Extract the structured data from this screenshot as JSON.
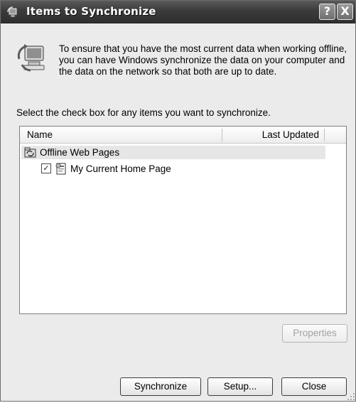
{
  "window": {
    "title": "Items to Synchronize",
    "help_glyph": "?",
    "close_glyph": "X"
  },
  "info": {
    "text": "To ensure that you have the most current data when working offline, you can have Windows synchronize the data on your computer and the data on the network so that both are up to date."
  },
  "instruction": "Select the check box for any items you want to synchronize.",
  "list": {
    "columns": [
      "Name",
      "Last Updated"
    ],
    "group": {
      "label": "Offline Web Pages"
    },
    "items": [
      {
        "label": "My Current Home Page",
        "checked": true,
        "last_updated": ""
      }
    ]
  },
  "buttons": {
    "properties": "Properties",
    "synchronize": "Synchronize",
    "setup": "Setup...",
    "close": "Close"
  },
  "icons": {
    "title": "sync-icon",
    "info": "sync-computer-icon",
    "group": "offline-web-pages-icon",
    "item": "web-page-icon"
  }
}
